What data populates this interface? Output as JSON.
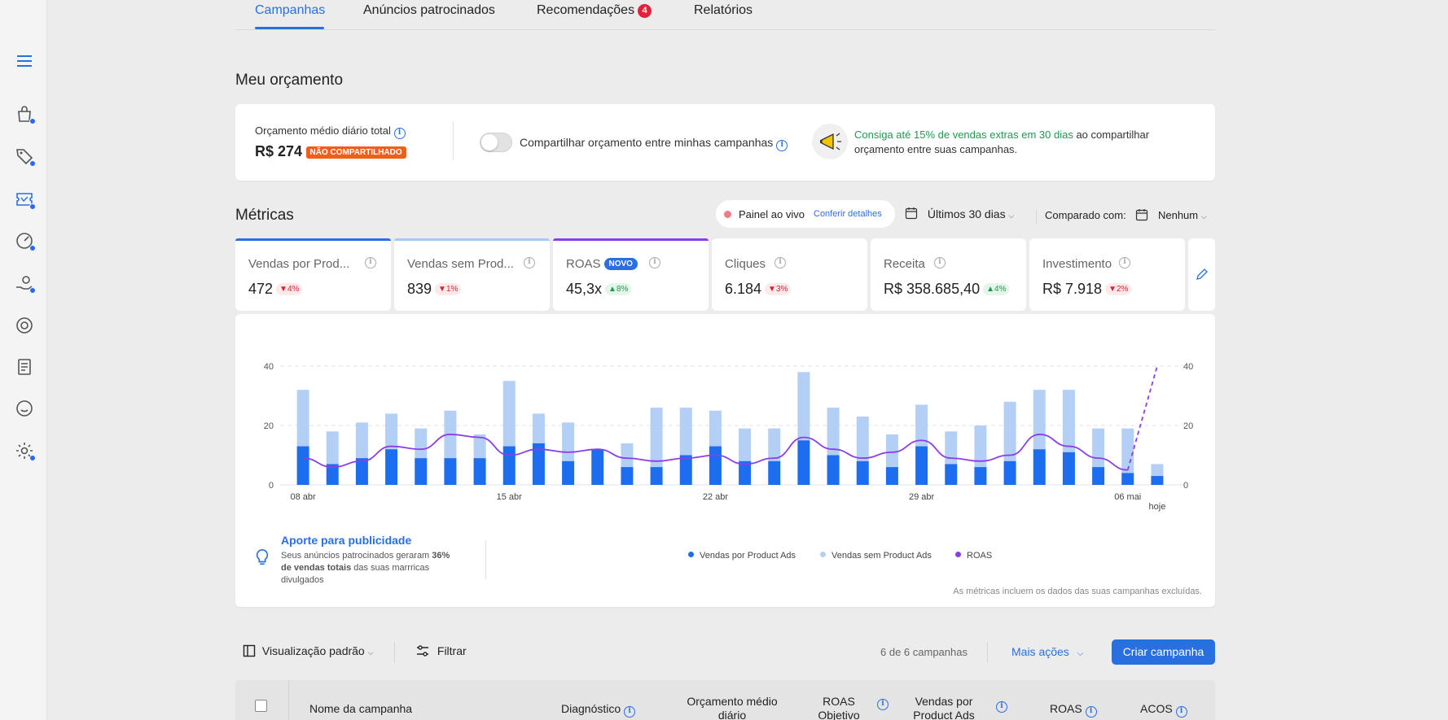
{
  "tabs": [
    {
      "label": "Campanhas"
    },
    {
      "label": "Anúncios patrocinados"
    },
    {
      "label": "Recomendações",
      "badge": "4"
    },
    {
      "label": "Relatórios"
    }
  ],
  "budget": {
    "title": "Meu orçamento",
    "label": "Orçamento médio diário total",
    "value": "R$ 274",
    "tag": "NÃO COMPARTILHADO",
    "toggle_label": "Compartilhar orçamento entre minhas campanhas",
    "promo_highlight": "Consiga até 15% de vendas extras em 30 dias",
    "promo_text1": " ao compartilhar",
    "promo_text2": "orçamento entre suas campanhas."
  },
  "metrics": {
    "title": "Métricas",
    "live_label": "Painel ao vivo",
    "live_link": "Conferir detalhes",
    "period": "Últimos 30 dias",
    "compare_label": "Comparado com:",
    "compare_value": "Nenhum",
    "cards": [
      {
        "label": "Vendas por Prod...",
        "value": "472",
        "delta": "4%",
        "dir": "down",
        "color": "#2a6fe0"
      },
      {
        "label": "Vendas sem Prod...",
        "value": "839",
        "delta": "1%",
        "dir": "down",
        "color": "#a9c7f5"
      },
      {
        "label": "ROAS",
        "tag": "NOVO",
        "value": "45,3x",
        "delta": "8%",
        "dir": "up",
        "color": "#8b3ee6"
      },
      {
        "label": "Cliques",
        "value": "6.184",
        "delta": "3%",
        "dir": "down",
        "color": ""
      },
      {
        "label": "Receita",
        "value": "R$ 358.685,40",
        "delta": "4%",
        "dir": "up",
        "color": ""
      },
      {
        "label": "Investimento",
        "value": "R$ 7.918",
        "delta": "2%",
        "dir": "down",
        "color": ""
      }
    ]
  },
  "chart_data": {
    "type": "bar",
    "series": [
      {
        "name": "Vendas por Product Ads",
        "type": "bar",
        "stack": "sales",
        "color": "#1d6df0",
        "values": [
          13,
          7,
          9,
          12,
          9,
          9,
          9,
          13,
          14,
          8,
          12,
          6,
          6,
          10,
          13,
          8,
          8,
          15,
          10,
          8,
          6,
          13,
          7,
          6,
          8,
          12,
          11,
          6,
          4,
          3
        ]
      },
      {
        "name": "Vendas sem Product Ads",
        "type": "bar",
        "stack": "sales",
        "color": "#b3cff6",
        "values": [
          19,
          11,
          12,
          12,
          10,
          16,
          8,
          22,
          10,
          13,
          0,
          8,
          20,
          16,
          12,
          11,
          11,
          23,
          16,
          15,
          11,
          14,
          11,
          14,
          20,
          20,
          21,
          13,
          15,
          4
        ]
      },
      {
        "name": "ROAS",
        "type": "line",
        "color": "#8b3ee6",
        "values": [
          9,
          6,
          8,
          13,
          12,
          17,
          16,
          10,
          12,
          11,
          12,
          9,
          8,
          9,
          10,
          7,
          9,
          16,
          12,
          9,
          11,
          15,
          9,
          8,
          10,
          17,
          13,
          9,
          5,
          40
        ]
      }
    ],
    "x_ticks": [
      {
        "index": 0,
        "label": "08 abr"
      },
      {
        "index": 7,
        "label": "15 abr"
      },
      {
        "index": 14,
        "label": "22 abr"
      },
      {
        "index": 21,
        "label": "29 abr"
      },
      {
        "index": 28,
        "label": "06 mai"
      },
      {
        "index": 29,
        "label": "hoje"
      }
    ],
    "ylim": [
      0,
      40
    ],
    "y_ticks": [
      0,
      20,
      40
    ],
    "grid": true,
    "legend": "bottom-center"
  },
  "insight": {
    "title": "Aporte para publicidade",
    "line1a": "Seus anúncios patrocinados geraram ",
    "line1b": "36%",
    "line2a": "de vendas totais",
    "line2b": " das suas marrricas",
    "line3": "divulgados"
  },
  "footnote": "As métricas incluem os dados das suas campanhas excluídas.",
  "toolbar": {
    "view": "Visualização padrão",
    "filter": "Filtrar",
    "count": "6 de 6 campanhas",
    "more": "Mais ações",
    "create": "Criar campanha"
  },
  "table": {
    "headers": [
      {
        "label": "Nome da campanha"
      },
      {
        "label": "Diagnóstico",
        "info": true
      },
      {
        "label": "Orçamento médio diário"
      },
      {
        "label": "ROAS Objetivo",
        "info": true
      },
      {
        "label": "Vendas por Product Ads",
        "info": true
      },
      {
        "label": "ROAS",
        "info": true
      },
      {
        "label": "ACOS",
        "info": true
      }
    ]
  },
  "colors": {
    "accent": "#2a6fe0",
    "success": "#1e9a4e",
    "alert": "#e0223b",
    "promo_tag": "#f35d1c"
  }
}
